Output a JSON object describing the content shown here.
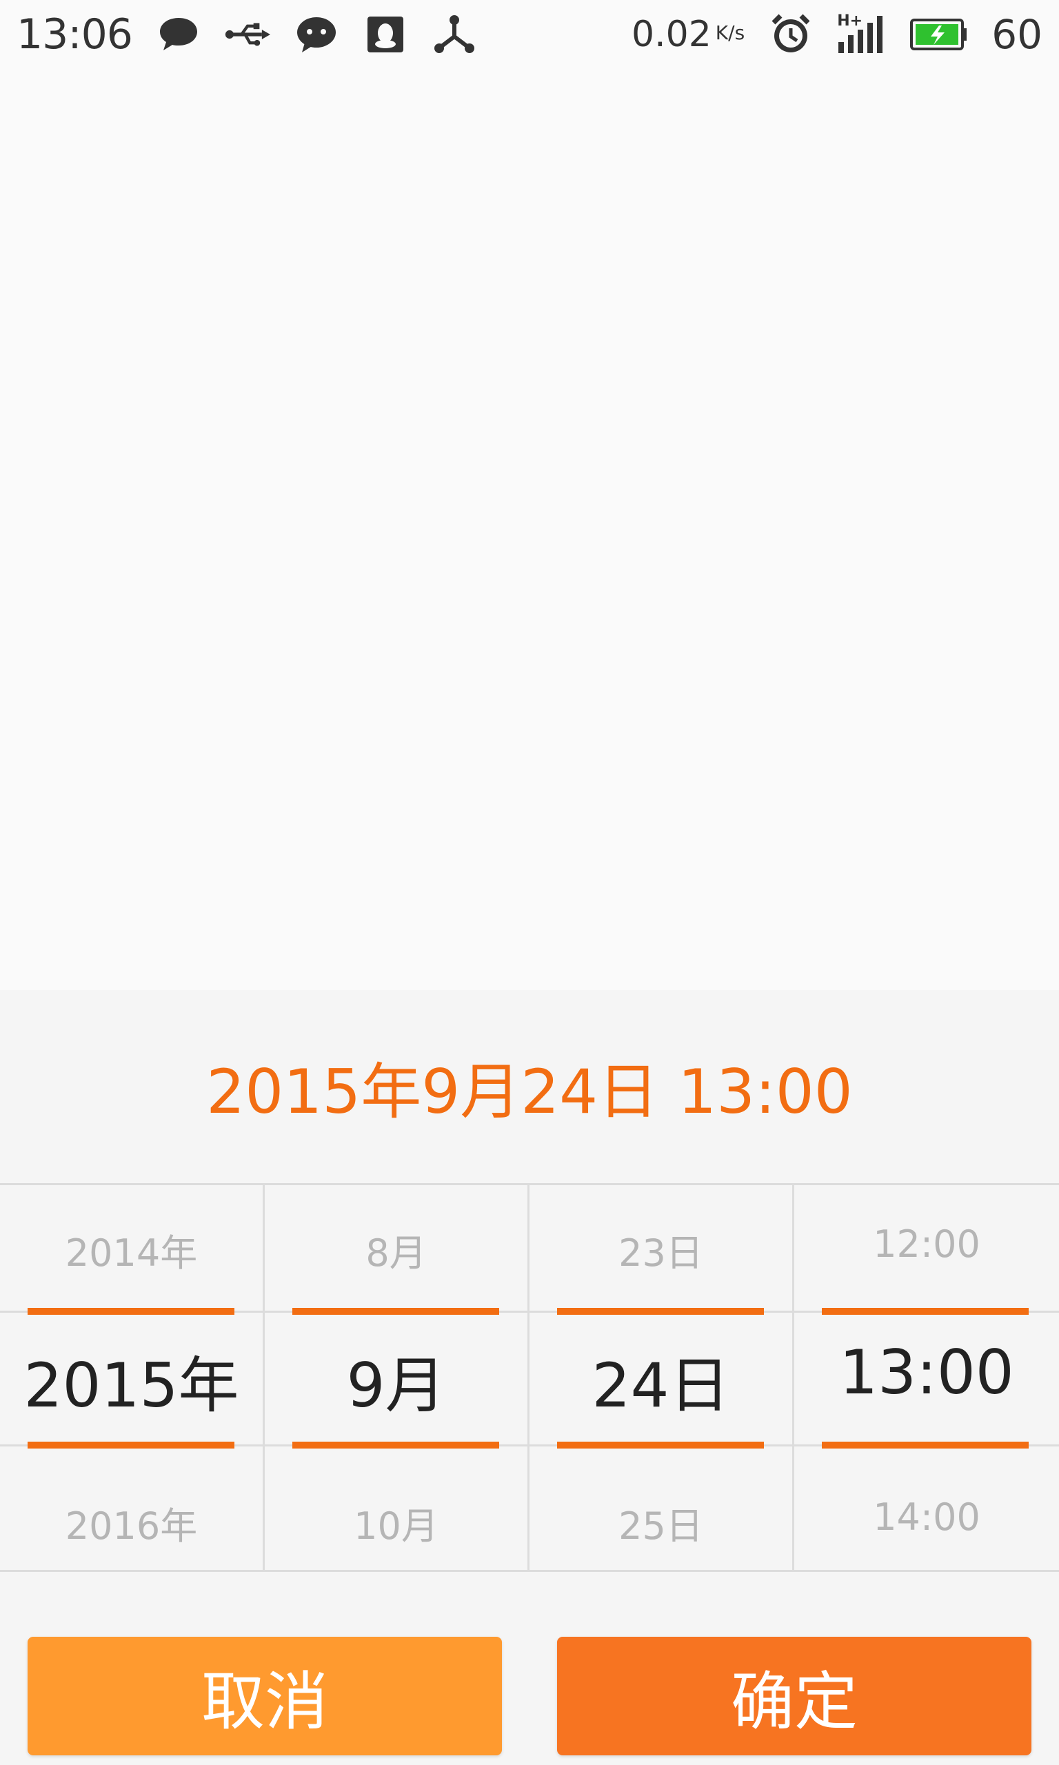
{
  "status_bar": {
    "time": "13:06",
    "network_speed": "0.02",
    "network_unit": "K/s",
    "signal_label": "H+",
    "battery_level": "60"
  },
  "picker": {
    "header": "2015年9月24日 13:00",
    "columns": [
      {
        "prev": "2014年",
        "selected": "2015年",
        "next": "2016年"
      },
      {
        "prev": "8月",
        "selected": "9月",
        "next": "10月"
      },
      {
        "prev": "23日",
        "selected": "24日",
        "next": "25日"
      },
      {
        "prev": "12:00",
        "selected": "13:00",
        "next": "14:00"
      }
    ]
  },
  "buttons": {
    "cancel": "取消",
    "confirm": "确定"
  },
  "colors": {
    "accent": "#f26d12",
    "cancel_bg": "#ff9a2f",
    "confirm_bg": "#f77421"
  }
}
